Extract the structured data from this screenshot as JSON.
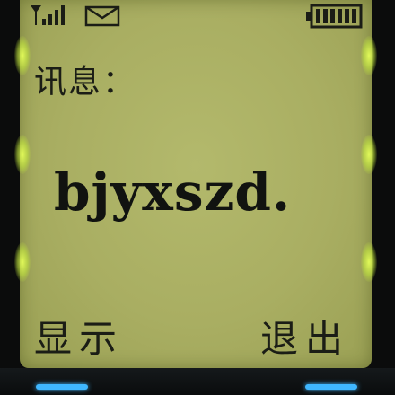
{
  "status_bar": {
    "signal_icon": "signal-bars-icon",
    "message_icon": "envelope-icon",
    "battery_icon": "battery-full-icon"
  },
  "screen": {
    "label": "讯息：",
    "message": "bjyxszd."
  },
  "softkeys": {
    "left": "显示",
    "right": "退出"
  },
  "colors": {
    "lcd_background": "#aab063",
    "lcd_text": "#1b1d16",
    "backlight_glow": "#d8f24a",
    "key_light": "#3fb7ff"
  }
}
